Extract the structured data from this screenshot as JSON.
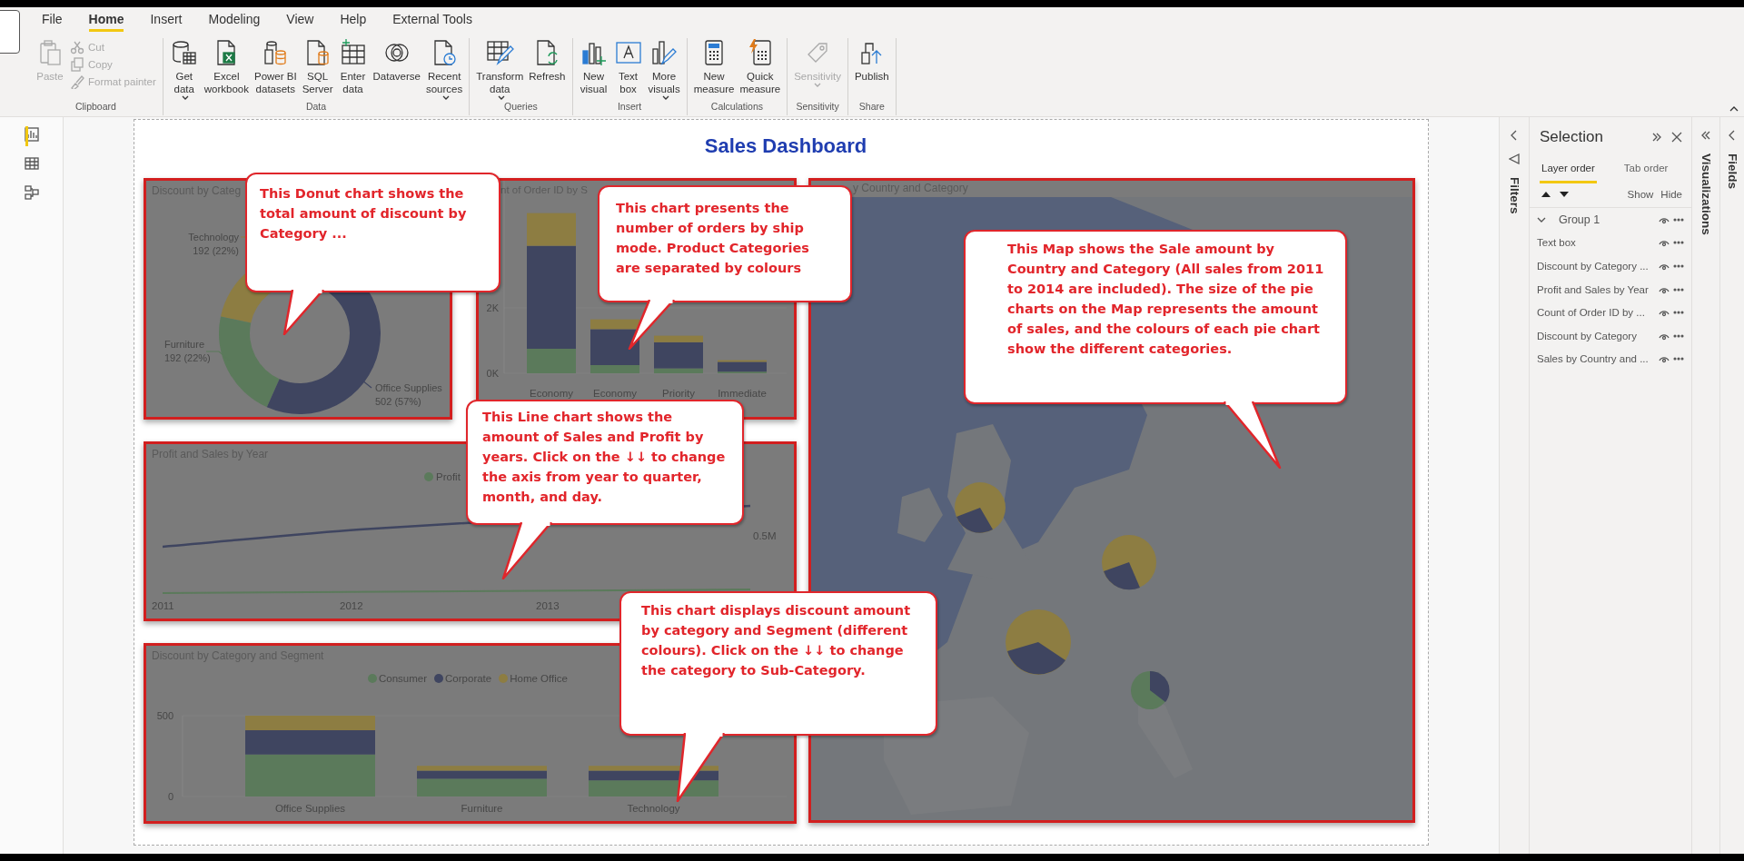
{
  "ribbon": {
    "tabs": [
      {
        "label": "File",
        "selected": false
      },
      {
        "label": "Home",
        "selected": true
      },
      {
        "label": "Insert",
        "selected": false
      },
      {
        "label": "Modeling",
        "selected": false
      },
      {
        "label": "View",
        "selected": false
      },
      {
        "label": "Help",
        "selected": false
      },
      {
        "label": "External Tools",
        "selected": false
      }
    ],
    "groups": [
      {
        "label": "Clipboard",
        "items": [
          {
            "kind": "large",
            "lines": [
              "Paste"
            ],
            "disabled": true,
            "dropdown": false
          },
          {
            "kind": "small",
            "lines": [
              "Cut"
            ],
            "disabled": true
          },
          {
            "kind": "small",
            "lines": [
              "Copy"
            ],
            "disabled": true
          },
          {
            "kind": "small",
            "lines": [
              "Format painter"
            ],
            "disabled": true
          }
        ]
      },
      {
        "label": "Data",
        "items": [
          {
            "kind": "large",
            "lines": [
              "Get",
              "data"
            ],
            "disabled": false,
            "dropdown": true
          },
          {
            "kind": "large",
            "lines": [
              "Excel",
              "workbook"
            ],
            "disabled": false,
            "dropdown": false
          },
          {
            "kind": "large",
            "lines": [
              "Power BI",
              "datasets"
            ],
            "disabled": false,
            "dropdown": false
          },
          {
            "kind": "large",
            "lines": [
              "SQL",
              "Server"
            ],
            "disabled": false,
            "dropdown": false
          },
          {
            "kind": "large",
            "lines": [
              "Enter",
              "data"
            ],
            "disabled": false,
            "dropdown": false
          },
          {
            "kind": "large",
            "lines": [
              "Dataverse"
            ],
            "disabled": false,
            "dropdown": false
          },
          {
            "kind": "large",
            "lines": [
              "Recent",
              "sources"
            ],
            "disabled": false,
            "dropdown": true
          }
        ]
      },
      {
        "label": "Queries",
        "items": [
          {
            "kind": "large",
            "lines": [
              "Transform",
              "data"
            ],
            "disabled": false,
            "dropdown": true
          },
          {
            "kind": "large",
            "lines": [
              "Refresh"
            ],
            "disabled": false,
            "dropdown": false
          }
        ]
      },
      {
        "label": "Insert",
        "items": [
          {
            "kind": "large",
            "lines": [
              "New",
              "visual"
            ],
            "disabled": false,
            "dropdown": false
          },
          {
            "kind": "large",
            "lines": [
              "Text",
              "box"
            ],
            "disabled": false,
            "dropdown": false
          },
          {
            "kind": "large",
            "lines": [
              "More",
              "visuals"
            ],
            "disabled": false,
            "dropdown": true
          }
        ]
      },
      {
        "label": "Calculations",
        "items": [
          {
            "kind": "large",
            "lines": [
              "New",
              "measure"
            ],
            "disabled": false,
            "dropdown": false
          },
          {
            "kind": "large",
            "lines": [
              "Quick",
              "measure"
            ],
            "disabled": false,
            "dropdown": false
          }
        ]
      },
      {
        "label": "Sensitivity",
        "items": [
          {
            "kind": "large",
            "lines": [
              "Sensitivity"
            ],
            "disabled": true,
            "dropdown": true
          }
        ]
      },
      {
        "label": "Share",
        "items": [
          {
            "kind": "large",
            "lines": [
              "Publish"
            ],
            "disabled": false,
            "dropdown": false
          }
        ]
      }
    ]
  },
  "page_title": "Sales Dashboard",
  "discount_donut": {
    "title": "Discount by Categ",
    "chart_data": {
      "type": "donut",
      "categories": [
        "Technology",
        "Furniture",
        "Office Supplies"
      ],
      "values": [
        192,
        192,
        502
      ],
      "value_labels": [
        "192 (22%)",
        "192 (22%)",
        "502 (57%)"
      ]
    }
  },
  "orders_bar": {
    "title": "nt of Order ID by S",
    "chart_data": {
      "type": "bar",
      "stacked": true,
      "categories": [
        "Economy",
        "Economy",
        "Priority",
        "Immediate"
      ],
      "ylim": [
        0,
        6140
      ],
      "yticks": [
        {
          "value": 0,
          "label": "0K"
        },
        {
          "value": 2000,
          "label": "2K"
        }
      ],
      "series": [
        {
          "color": "#5b7a5b",
          "values": [
            750,
            250,
            150,
            50
          ]
        },
        {
          "color": "#3f4560",
          "values": [
            3150,
            1100,
            800,
            300
          ]
        },
        {
          "color": "#8d7d42",
          "values": [
            1000,
            300,
            200,
            50
          ]
        }
      ]
    }
  },
  "profit_sales_line": {
    "title": "Profit and Sales by Year",
    "legend": "Profit",
    "x_labels": [
      "2011",
      "2012",
      "2013"
    ],
    "y_label": "0.5M"
  },
  "segment_bar": {
    "title": "Discount by Category and Segment",
    "chart_data": {
      "type": "bar",
      "stacked": true,
      "categories": [
        "Office Supplies",
        "Furniture",
        "Technology"
      ],
      "ylim": [
        0,
        500
      ],
      "yticks": [
        0,
        500
      ],
      "series": [
        {
          "name": "Consumer",
          "color": "#5b7a5b",
          "values": [
            260,
            110,
            100
          ]
        },
        {
          "name": "Corporate",
          "color": "#3f4560",
          "values": [
            150,
            50,
            60
          ]
        },
        {
          "name": "Home Office",
          "color": "#8d7d42",
          "values": [
            90,
            30,
            30
          ]
        }
      ]
    }
  },
  "sales_map": {
    "title": "y Country and Category",
    "kind": "picture"
  },
  "callouts": [
    "This Donut chart shows the total amount of discount by Category ...",
    "This chart presents the number of orders by ship mode. Product Categories are separated by colours",
    "This Map shows the Sale amount by Country and Category (All sales from 2011 to 2014 are included). The size of the pie charts on the Map represents the amount of sales, and the colours of each pie chart show the different categories.",
    "This Line chart shows the amount of Sales and Profit by years. Click on the ↓↓ to change the axis from year to quarter, month, and day.",
    "This chart displays discount amount by category and Segment (different colours). Click on the ↓↓ to change the category to Sub-Category."
  ],
  "filters_pane": {
    "label": "Filters"
  },
  "selection_pane": {
    "title": "Selection",
    "tabs": [
      {
        "label": "Layer order",
        "selected": true
      },
      {
        "label": "Tab order",
        "selected": false
      }
    ],
    "show_label": "Show",
    "hide_label": "Hide",
    "layers": [
      {
        "kind": "group",
        "label": "Group 1",
        "expanded": true
      },
      {
        "kind": "visual",
        "label": "Text box"
      },
      {
        "kind": "visual",
        "label": "Discount by Category ..."
      },
      {
        "kind": "visual",
        "label": "Profit and Sales by Year"
      },
      {
        "kind": "visual",
        "label": "Count of Order ID by ..."
      },
      {
        "kind": "visual",
        "label": "Discount by Category"
      },
      {
        "kind": "visual",
        "label": "Sales by Country and ..."
      }
    ]
  },
  "visualizations_pane": {
    "label": "Visualizations"
  },
  "fields_pane": {
    "label": "Fields"
  }
}
